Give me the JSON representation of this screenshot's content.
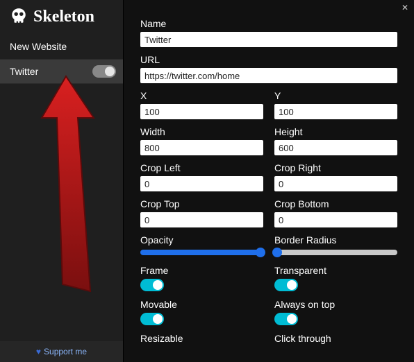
{
  "app": {
    "title": "Skeleton"
  },
  "sidebar": {
    "new_site_label": "New Website",
    "items": [
      {
        "name": "Twitter",
        "enabled": false
      }
    ],
    "support_label": "Support me"
  },
  "form": {
    "name_label": "Name",
    "name_value": "Twitter",
    "url_label": "URL",
    "url_value": "https://twitter.com/home",
    "x_label": "X",
    "x_value": "100",
    "y_label": "Y",
    "y_value": "100",
    "width_label": "Width",
    "width_value": "800",
    "height_label": "Height",
    "height_value": "600",
    "crop_left_label": "Crop Left",
    "crop_left_value": "0",
    "crop_right_label": "Crop Right",
    "crop_right_value": "0",
    "crop_top_label": "Crop Top",
    "crop_top_value": "0",
    "crop_bottom_label": "Crop Bottom",
    "crop_bottom_value": "0",
    "opacity_label": "Opacity",
    "opacity_value": 1.0,
    "border_radius_label": "Border Radius",
    "border_radius_value": 0,
    "frame_label": "Frame",
    "frame_on": true,
    "transparent_label": "Transparent",
    "transparent_on": true,
    "movable_label": "Movable",
    "movable_on": true,
    "always_on_top_label": "Always on top",
    "always_on_top_on": true,
    "resizable_label": "Resizable",
    "click_through_label": "Click through"
  }
}
